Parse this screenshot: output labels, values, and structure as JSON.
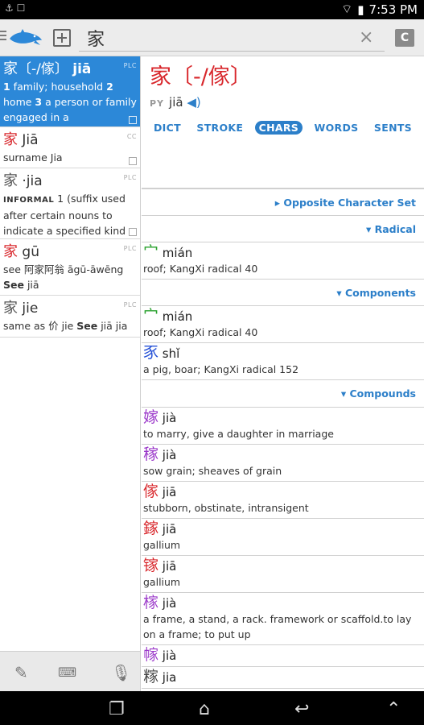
{
  "status": {
    "time": "7:53 PM"
  },
  "search": {
    "value": "家",
    "clear_icon": "×",
    "mode_label": "C"
  },
  "results": [
    {
      "tag": "PLC",
      "hw": "家",
      "trad": "〔-/傢〕",
      "py": "jiā",
      "def_parts": [
        "1",
        " family; household ",
        "2",
        " home ",
        "3",
        " a person or family engaged in a"
      ],
      "selected": true
    },
    {
      "tag": "CC",
      "hw": "家",
      "py": "Jiā",
      "def": "surname Jia"
    },
    {
      "tag": "PLC",
      "hw": "家",
      "py": "·jia",
      "def_label": "INFORMAL",
      "def": " 1 (suffix used after certain nouns to indicate a specified kind"
    },
    {
      "tag": "PLC",
      "hw": "家",
      "py": "gū",
      "def": "see 阿家阿翁 āgū-āwēng ",
      "see": "See",
      "see_target": " jiā"
    },
    {
      "tag": "PLC",
      "hw": "家",
      "py": "jie",
      "def": "same as 价 jie ",
      "see": "See",
      "see_target": " jiā jia"
    }
  ],
  "entry": {
    "headword": "家〔-/傢〕",
    "py_label": "PY",
    "pinyin": "jiā",
    "tabs": [
      "DICT",
      "STROKE",
      "CHARS",
      "WORDS",
      "SENTS"
    ],
    "active_tab": "CHARS"
  },
  "sections": {
    "opposite": "▸ Opposite Character Set",
    "radical": "▾ Radical",
    "components": "▾ Components",
    "compounds": "▾ Compounds"
  },
  "radical": [
    {
      "ch": "宀",
      "py": "mián",
      "def": "roof; KangXi radical 40",
      "color": "g"
    }
  ],
  "components": [
    {
      "ch": "宀",
      "py": "mián",
      "def": "roof; KangXi radical 40",
      "color": "g"
    },
    {
      "ch": "豕",
      "py": "shǐ",
      "def": "a pig, boar; KangXi radical 152",
      "color": "b"
    }
  ],
  "compounds": [
    {
      "ch": "嫁",
      "py": "jià",
      "def": "to marry, give a daughter in marriage",
      "color": "p"
    },
    {
      "ch": "稼",
      "py": "jià",
      "def": "sow grain; sheaves of grain",
      "color": "p"
    },
    {
      "ch": "傢",
      "py": "jiā",
      "def": "stubborn, obstinate, intransigent",
      "color": "r"
    },
    {
      "ch": "鎵",
      "py": "jiā",
      "def": "gallium",
      "color": "r"
    },
    {
      "ch": "镓",
      "py": "jiā",
      "def": "gallium",
      "color": "r"
    },
    {
      "ch": "榢",
      "py": "jià",
      "def": "a frame, a stand, a rack. framework or scaffold.to lay on a frame; to put up",
      "color": "p"
    },
    {
      "ch": "幏",
      "py": "jià",
      "def": "",
      "color": "p"
    },
    {
      "ch": "糘",
      "py": "jia",
      "def": "",
      "color": "k"
    }
  ]
}
